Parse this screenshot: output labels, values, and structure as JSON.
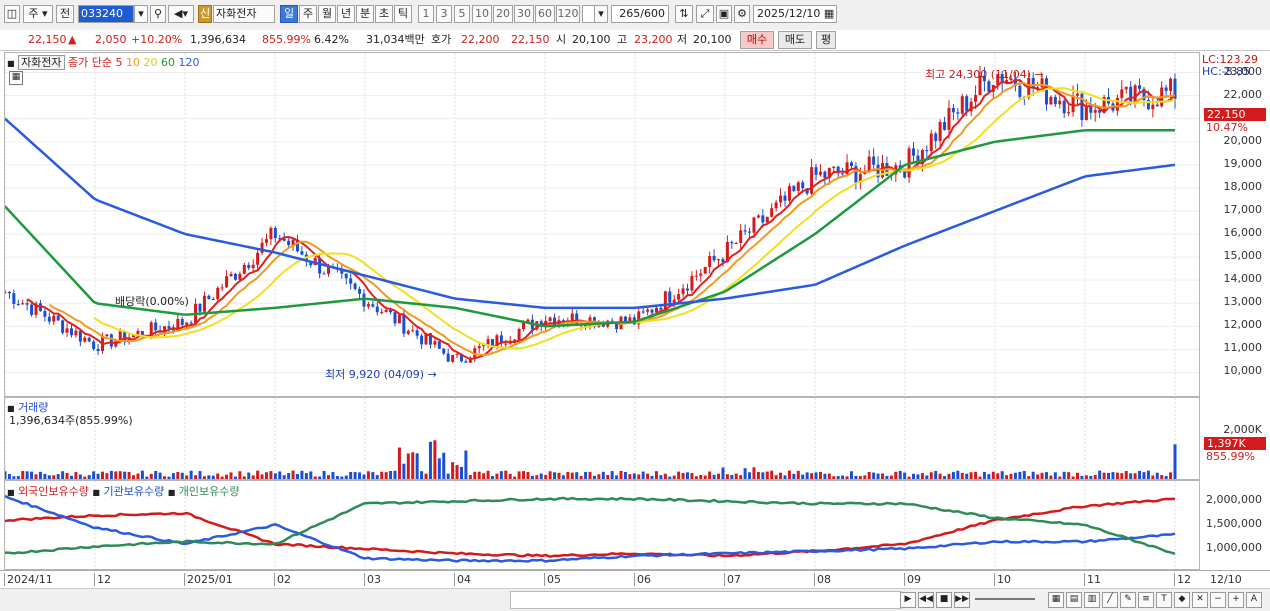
{
  "toolbar": {
    "period_unit": "주",
    "prev_label": "전",
    "stock_code": "033240",
    "new_badge": "신",
    "stock_name": "자화전자",
    "periods": [
      "일",
      "주",
      "월",
      "년",
      "분",
      "초",
      "틱"
    ],
    "minutes": [
      "1",
      "3",
      "5",
      "10",
      "20",
      "30",
      "60",
      "120"
    ],
    "count": "265",
    "count_total": "/600",
    "date": "2025/12/10"
  },
  "quote": {
    "price": "22,150",
    "change_arrow": "▲",
    "change": "2,050",
    "change_pct": "+10.20%",
    "volume": "1,396,634",
    "volume_ratio": "855.99%",
    "turnover": "6.42%",
    "amount": "31,034백만",
    "bid_label": "호가",
    "bid": "22,200",
    "ask": "22,150",
    "open_label": "시",
    "open": "20,100",
    "high_label": "고",
    "high": "23,200",
    "low_label": "저",
    "low": "20,100",
    "buy_button": "매수",
    "sell_button": "매도",
    "eval_button": "평"
  },
  "price_pane": {
    "legend_name": "자화전자",
    "legend_ma_label": "종가 단순",
    "ma_periods": [
      "5",
      "10",
      "20",
      "60",
      "120"
    ],
    "ma_colors": [
      "#e0201e",
      "#f29a1e",
      "#f0e020",
      "#1e9a3c",
      "#2a5ae0"
    ],
    "annotation_high": "최고 24,300 (11/04)",
    "annotation_low": "최저 9,920 (04/09)",
    "annotation_dividend": "배당락(0.00%)",
    "lc_label": "LC:123.29",
    "hc_label": "HC:-8.85",
    "current_price_tag": "22,150",
    "current_pct_tag": "10.47%",
    "y_ticks": [
      "23,000",
      "22,000",
      "21,000",
      "20,000",
      "19,000",
      "18,000",
      "17,000",
      "16,000",
      "15,000",
      "14,000",
      "13,000",
      "12,000",
      "11,000",
      "10,000"
    ]
  },
  "volume_pane": {
    "title": "거래량",
    "value": "1,396,634주(855.99%)",
    "y_tick": "2,000K",
    "current_tag": "1,397K",
    "current_pct": "855.99%"
  },
  "holding_pane": {
    "legend": [
      "외국인보유수량",
      "기관보유수량",
      "개인보유수량"
    ],
    "colors": [
      "#d41a1a",
      "#2a5ae0",
      "#2e8b57"
    ],
    "y_ticks": [
      "2,000,000",
      "1,500,000",
      "1,000,000"
    ]
  },
  "x_axis": {
    "labels": [
      "2024/11",
      "12",
      "2025/01",
      "02",
      "03",
      "04",
      "05",
      "06",
      "07",
      "08",
      "09",
      "10",
      "11",
      "12"
    ],
    "right_label": "12/10"
  },
  "chart_data": {
    "type": "line",
    "title": "",
    "note": "Daily candlestick chart, Nov 2024 – Dec 10 2025; approximate closing prices read from chart",
    "x": [
      "2024-11",
      "2024-12",
      "2025-01",
      "2025-02",
      "2025-03",
      "2025-04",
      "2025-05",
      "2025-06",
      "2025-07",
      "2025-08",
      "2025-09",
      "2025-10",
      "2025-11",
      "2025-12"
    ],
    "series": [
      {
        "name": "종가",
        "values": [
          13500,
          11200,
          12200,
          16000,
          13200,
          10500,
          12400,
          12200,
          15200,
          18500,
          19000,
          23000,
          21500,
          22150
        ]
      },
      {
        "name": "60",
        "values": [
          17200,
          13000,
          12500,
          12800,
          13200,
          12800,
          12000,
          12200,
          13500,
          16000,
          19000,
          20000,
          20500,
          20500
        ]
      },
      {
        "name": "120",
        "values": [
          21000,
          17500,
          16000,
          15200,
          14200,
          13200,
          12800,
          12800,
          13200,
          13800,
          15500,
          17000,
          18500,
          19000
        ]
      }
    ],
    "ylim": [
      9500,
      23500
    ],
    "volume_max": 2500000,
    "holdings": {
      "외국인보유수량": [
        1600000,
        1700000,
        1750000,
        1100000,
        1000000,
        900000,
        850000,
        900000,
        850000,
        950000,
        1100000,
        1600000,
        1900000,
        2050000
      ],
      "기관보유수량": [
        2100000,
        1450000,
        1100000,
        1500000,
        800000,
        750000,
        750000,
        850000,
        900000,
        950000,
        1000000,
        1150000,
        1150000,
        1300000
      ],
      "개인보유수량": [
        900000,
        1050000,
        1150000,
        1100000,
        1950000,
        2000000,
        2050000,
        2050000,
        2000000,
        1950000,
        1950000,
        1650000,
        1500000,
        900000
      ]
    }
  }
}
